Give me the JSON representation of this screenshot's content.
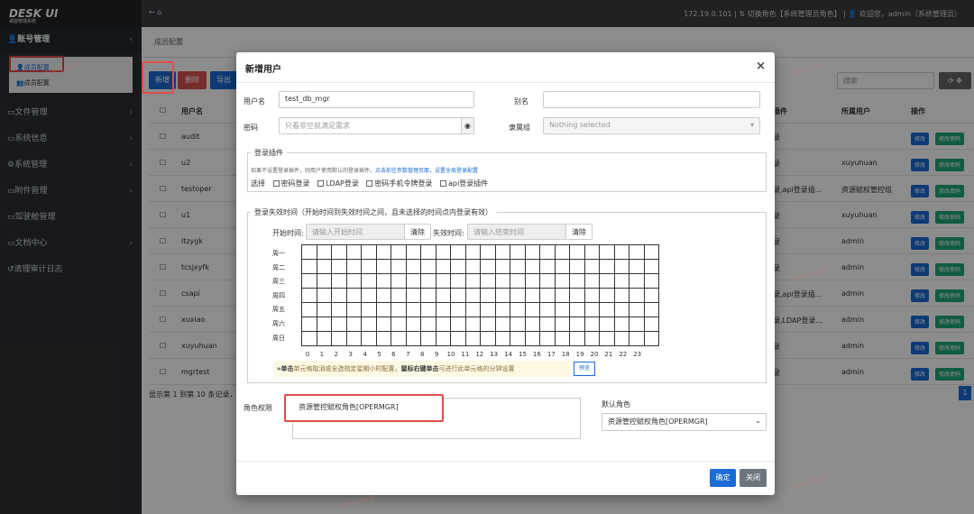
{
  "app": {
    "logo": "DESK UI",
    "logo_sub": "桌面管理系统"
  },
  "topbar": {
    "ip": "172.19.0.101",
    "switch_role": "切换角色【系统管理员角色】",
    "welcome": "欢迎您，admin（系统管理员）"
  },
  "sidebar": {
    "items": [
      {
        "label": "账号管理",
        "icon": "user-icon"
      },
      {
        "label": "文件管理"
      },
      {
        "label": "系统信息"
      },
      {
        "label": "系统管理"
      },
      {
        "label": "附件管理"
      },
      {
        "label": "驾驶舱管理"
      },
      {
        "label": "文档中心"
      },
      {
        "label": "清理审计日志"
      }
    ],
    "sub": [
      {
        "label": "成员配置"
      },
      {
        "label": "成员配置"
      }
    ]
  },
  "page": {
    "breadcrumb": "成员配置",
    "new_btn": "新增",
    "del_btn": "删除",
    "export_btn": "导出",
    "search_placeholder": "搜索",
    "col_user": "用户名",
    "col_plugin": "插件",
    "col_owner": "所属用户",
    "col_ops": "操作",
    "rows": [
      {
        "user": "audit",
        "plugin": "录",
        "owner": ""
      },
      {
        "user": "u2",
        "plugin": "录",
        "owner": "xuyuhuan"
      },
      {
        "user": "testoper",
        "plugin": "录,api登录插...",
        "owner": "资源赋权管控组"
      },
      {
        "user": "u1",
        "plugin": "录",
        "owner": "xuyuhuan"
      },
      {
        "user": "ltzygk",
        "plugin": "录",
        "owner": "admin"
      },
      {
        "user": "tcsjxyfk",
        "plugin": "录",
        "owner": "admin"
      },
      {
        "user": "csapi",
        "plugin": "录,api登录插...",
        "owner": "admin"
      },
      {
        "user": "xuxiao",
        "plugin": "录,LDAP登录...",
        "owner": "admin"
      },
      {
        "user": "xuyuhuan",
        "plugin": "录",
        "owner": "admin"
      },
      {
        "user": "mgrtest",
        "plugin": "录",
        "owner": "admin"
      }
    ],
    "edit_label": "修改",
    "edit_pwd_label": "修改密码",
    "footer_count": "显示第 1 到第 10 条记录，",
    "page_num": "1"
  },
  "modal": {
    "title": "新增用户",
    "username_label": "用户名",
    "username_value": "test_db_mgr",
    "alias_label": "别名",
    "alias_value": "",
    "password_label": "密码",
    "password_placeholder": "只看非空就满足需求",
    "group_label": "隶属组",
    "group_placeholder": "Nothing selected",
    "login_plugin_legend": "登录插件",
    "login_plugin_note": "如果不设置登录插件，则用户使用默认的登录插件。",
    "login_plugin_link1": "点击前往参数管理页面，",
    "login_plugin_link2": "设置全局登录配置",
    "choose_label": "选择",
    "plugins": [
      "密码登录",
      "LDAP登录",
      "密码手机令牌登录",
      "api登录插件"
    ],
    "time_legend": "登录失效时间（开始时间到失效时间之间，且未选择的时间点内登录有效）",
    "start_label": "开始时间:",
    "start_placeholder": "请输入开始时间",
    "clear_label": "清除",
    "end_label": "失效时间:",
    "end_placeholder": "请输入结束时间",
    "days": [
      "周一",
      "周二",
      "周三",
      "周四",
      "周五",
      "周六",
      "周日"
    ],
    "hours": [
      "0",
      "1",
      "2",
      "3",
      "4",
      "5",
      "6",
      "7",
      "8",
      "9",
      "10",
      "11",
      "12",
      "13",
      "14",
      "15",
      "16",
      "17",
      "18",
      "19",
      "20",
      "21",
      "22",
      "23"
    ],
    "tip_prefix": "»单击",
    "tip_text1": "单元格取消或全选指定星期小时配置，",
    "tip_bold": "鼠标右键单击",
    "tip_text2": "可进行此单元格的分钟设置",
    "preview_label": "预览",
    "role_label": "角色权限",
    "role_value": "资源管控赋权角色[OPERMGR]",
    "default_role_label": "默认角色",
    "default_role_value": "资源管控赋权角色[OPERMGR]",
    "confirm_label": "确定",
    "close_label": "关闭"
  },
  "watermark": "非商业测试版",
  "colors": {
    "primary": "#1a6bd6",
    "danger": "#d9534f",
    "success": "#1fa67a",
    "highlight": "#e24b4b"
  }
}
